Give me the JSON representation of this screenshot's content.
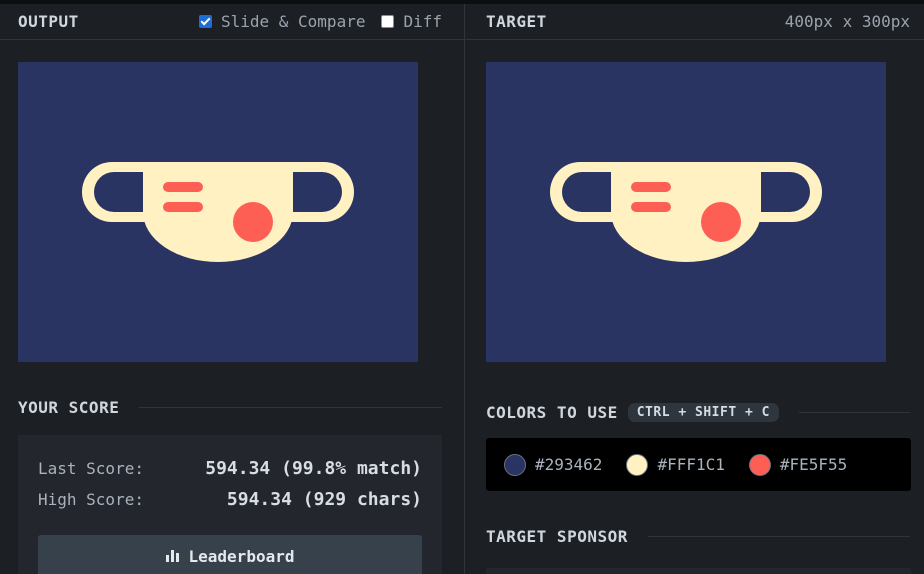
{
  "output": {
    "title": "OUTPUT",
    "slide_compare": {
      "label": "Slide & Compare",
      "checked": true
    },
    "diff": {
      "label": "Diff",
      "checked": false
    }
  },
  "target": {
    "title": "TARGET",
    "size": "400px x 300px"
  },
  "score": {
    "title": "YOUR SCORE",
    "last_label": "Last Score:",
    "last_value": "594.34 (99.8% match)",
    "high_label": "High Score:",
    "high_value": "594.34 (929 chars)",
    "leaderboard_label": "Leaderboard"
  },
  "colors": {
    "title": "COLORS TO USE",
    "shortcut": "CTRL + SHIFT + C",
    "swatches": [
      {
        "hex": "#293462"
      },
      {
        "hex": "#FFF1C1"
      },
      {
        "hex": "#FE5F55"
      }
    ]
  },
  "sponsor": {
    "title": "TARGET SPONSOR"
  }
}
